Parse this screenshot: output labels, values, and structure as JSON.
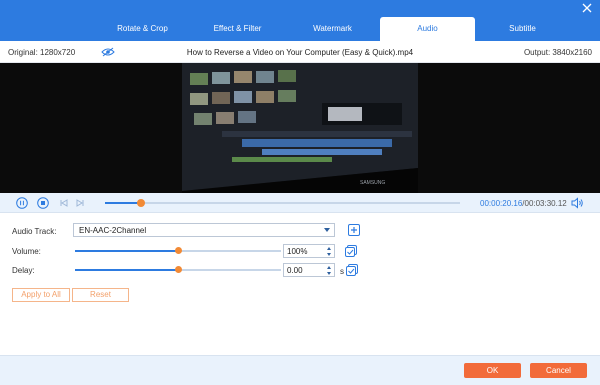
{
  "header": {
    "tabs": [
      {
        "label": "Rotate & Crop",
        "active": false
      },
      {
        "label": "Effect & Filter",
        "active": false
      },
      {
        "label": "Watermark",
        "active": false
      },
      {
        "label": "Audio",
        "active": true
      },
      {
        "label": "Subtitle",
        "active": false
      }
    ],
    "close_icon": "close-icon"
  },
  "info": {
    "original": "Original: 1280x720",
    "filename": "How to Reverse a Video on Your Computer (Easy & Quick).mp4",
    "output": "Output: 3840x2160",
    "eye_icon": "eye-slash-icon"
  },
  "preview": {
    "screen_brand": "SAMSUNG"
  },
  "playback": {
    "current_time": "00:00:20.16",
    "total_time": "/00:03:30.12",
    "progress": 0.1
  },
  "audio": {
    "track_label": "Audio Track:",
    "track_value": "EN-AAC-2Channel",
    "volume_label": "Volume:",
    "volume_value": "100%",
    "volume_level": 0.5,
    "delay_label": "Delay:",
    "delay_value": "0.00",
    "delay_level": 0.5,
    "delay_unit": "s",
    "apply_all_label": "Apply to All",
    "reset_label": "Reset"
  },
  "footer": {
    "ok_label": "OK",
    "cancel_label": "Cancel"
  },
  "colors": {
    "accent": "#2d7be0",
    "orange": "#f26b3a",
    "knob": "#f28a35"
  }
}
